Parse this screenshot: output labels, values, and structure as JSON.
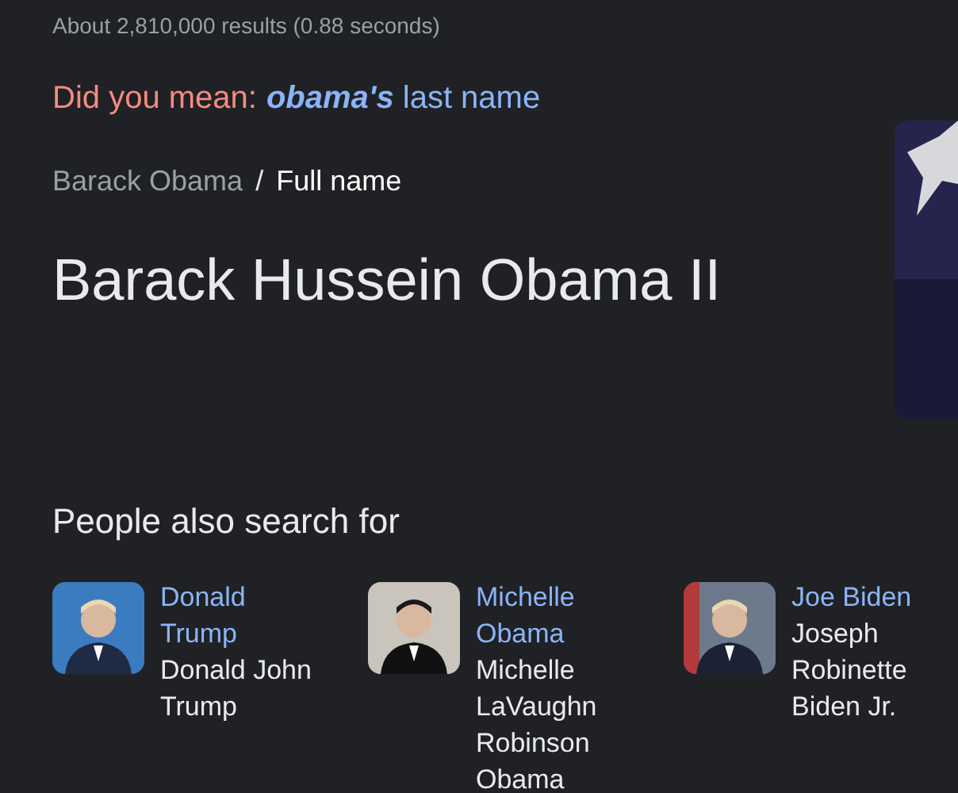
{
  "results_count": "About 2,810,000 results (0.88 seconds)",
  "did_you_mean": {
    "prefix": "Did you mean:",
    "suggestion": [
      "obama's",
      "last name"
    ]
  },
  "breadcrumb": {
    "parent": "Barack Obama",
    "separator": "/",
    "current": "Full name"
  },
  "answer": "Barack Hussein Obama II",
  "people_also_search": {
    "heading": "People also search for",
    "people": [
      {
        "name": "Donald Trump",
        "full_name": "Donald John Trump"
      },
      {
        "name": "Michelle Obama",
        "full_name": "Michelle LaVaughn Robinson Obama"
      },
      {
        "name": "Joe Biden",
        "full_name": "Joseph Robinette Biden Jr."
      }
    ]
  }
}
